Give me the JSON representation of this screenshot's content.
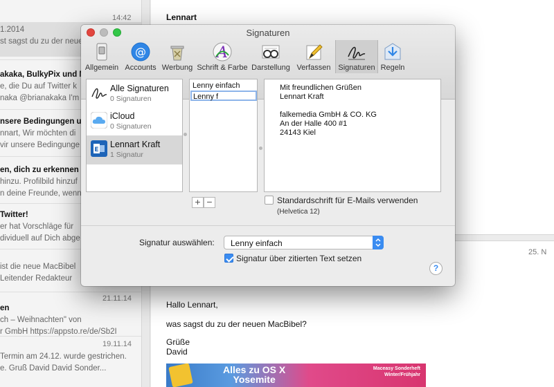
{
  "background": {
    "list_items": [
      {
        "date": "14:42",
        "lines": [
          "1.2014",
          "st sagst du zu der neuen"
        ]
      },
      {
        "lines": [
          "akaka, BulkyPix und Mi",
          "e, die Du auf Twitter k",
          "naka @brianakaka I'm t"
        ]
      },
      {
        "lines": [
          "nsere Bedingungen un",
          "nnart, Wir möchten di",
          "vir unsere Bedingunge"
        ]
      },
      {
        "lines": [
          "en, dich zu erkennen",
          "hinzu. Profilbild hinzuf",
          "n deine Freunde, wenn"
        ]
      },
      {
        "lines": [
          "Twitter!",
          "er hat Vorschläge für",
          "dividuell auf Dich abge"
        ]
      },
      {
        "lines": [
          "",
          "ist die neue MacBibel",
          "Leitender Redakteur"
        ]
      },
      {
        "date": "21.11.14",
        "lines": [
          "en",
          "ch – Weihnachten\" von",
          "r GmbH https://appsto.re/de/Sb2I"
        ]
      },
      {
        "date": "19.11.14",
        "lines": [
          "",
          "Termin am 24.12. wurde gestrichen.",
          "e. Gruß David David Sonder..."
        ]
      }
    ],
    "reader": {
      "sender_top": "Lennart",
      "date_right": "25. N",
      "greeting": "Hallo Lennart,",
      "body": "was sagst du zu der neuen MacBibel?",
      "closing": "Grüße",
      "name": "David",
      "banner_title": "Alles zu OS X\nYosemite",
      "banner_side": "Maceasy Sonderheft\nWinter/Frühjahr"
    }
  },
  "dialog": {
    "title": "Signaturen",
    "toolbar": [
      {
        "label": "Allgemein",
        "icon": "switch-icon"
      },
      {
        "label": "Accounts",
        "icon": "at-icon"
      },
      {
        "label": "Werbung",
        "icon": "trash-icon"
      },
      {
        "label": "Schrift & Farbe",
        "icon": "font-icon"
      },
      {
        "label": "Darstellung",
        "icon": "glasses-icon"
      },
      {
        "label": "Verfassen",
        "icon": "pencil-icon"
      },
      {
        "label": "Signaturen",
        "icon": "signature-icon",
        "active": true
      },
      {
        "label": "Regeln",
        "icon": "rules-icon"
      }
    ],
    "accounts": [
      {
        "name": "Alle Signaturen",
        "count": "0 Signaturen",
        "icon": "signature-icon"
      },
      {
        "name": "iCloud",
        "count": "0 Signaturen",
        "icon": "cloud-icon"
      },
      {
        "name": "Lennart Kraft",
        "count": "1 Signatur",
        "icon": "exchange-icon",
        "selected": true
      }
    ],
    "signatures": [
      {
        "name": "Lenny einfach"
      },
      {
        "name": "Lenny f",
        "editing": true
      }
    ],
    "preview_lines": [
      "Mit freundlichen Grüßen",
      "Lennart Kraft",
      "",
      "falkemedia GmbH & CO. KG",
      "An der Halle 400 #1",
      "24143 Kiel"
    ],
    "add_label": "+",
    "remove_label": "−",
    "default_font_label": "Standardschrift für E-Mails verwenden",
    "default_font_value": "(Helvetica 12)",
    "choose_label": "Signatur auswählen:",
    "choose_value": "Lenny einfach",
    "above_quote_label": "Signatur über zitierten Text setzen",
    "help_label": "?"
  },
  "colors": {
    "accent": "#3a8cf1",
    "close": "#e2463f",
    "minimize": "#bcbcbc",
    "maximize": "#33c748"
  }
}
